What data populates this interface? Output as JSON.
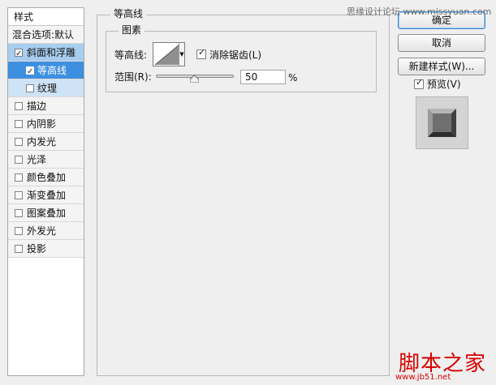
{
  "style_panel": {
    "title": "样式",
    "default_item": "混合选项:默认",
    "items": [
      {
        "label": "斜面和浮雕",
        "checked": true
      },
      {
        "label": "等高线",
        "checked": true
      },
      {
        "label": "纹理",
        "checked": false
      },
      {
        "label": "描边",
        "checked": false
      },
      {
        "label": "内阴影",
        "checked": false
      },
      {
        "label": "内发光",
        "checked": false
      },
      {
        "label": "光泽",
        "checked": false
      },
      {
        "label": "颜色叠加",
        "checked": false
      },
      {
        "label": "渐变叠加",
        "checked": false
      },
      {
        "label": "图案叠加",
        "checked": false
      },
      {
        "label": "外发光",
        "checked": false
      },
      {
        "label": "投影",
        "checked": false
      }
    ]
  },
  "main": {
    "section_title": "等高线",
    "group_title": "图素",
    "contour_label": "等高线:",
    "anti_alias_label": "消除锯齿(L)",
    "anti_alias_checked": true,
    "range_label": "范围(R):",
    "range_value": "50",
    "range_unit": "%",
    "range_fraction": 0.5
  },
  "buttons": {
    "ok": "确定",
    "cancel": "取消",
    "new_style": "新建样式(W)..."
  },
  "preview": {
    "label": "预览(V)",
    "checked": true
  },
  "watermarks": {
    "top": "思缘设计论坛 www.missyuan.com",
    "site_cn": "脚本之家",
    "site_url": "www.jb51.net"
  },
  "colors": {
    "selection_active": "#3d8fe0",
    "selection_main": "#a7cdef",
    "watermark_red": "#d90000"
  }
}
